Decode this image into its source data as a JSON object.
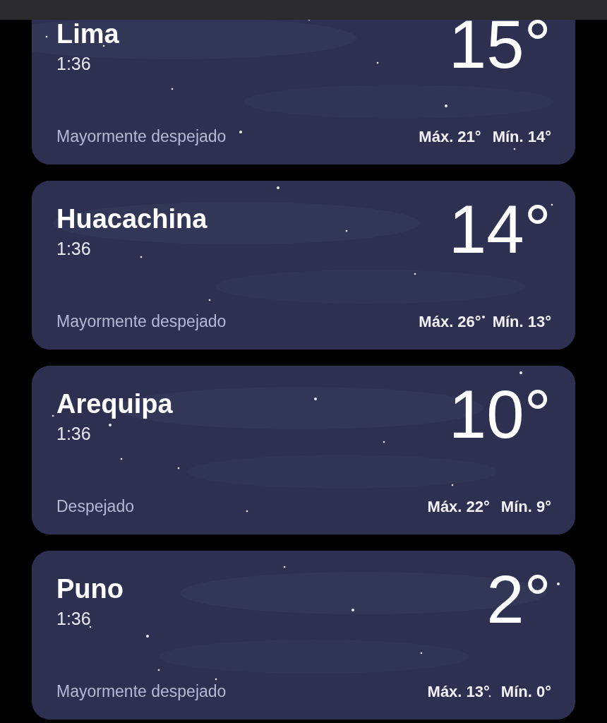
{
  "locations": [
    {
      "name": "Lima",
      "time": "1:36",
      "condition": "Mayormente despejado",
      "temperature": "15°",
      "high": "Máx. 21°",
      "low": "Mín. 14°"
    },
    {
      "name": "Huacachina",
      "time": "1:36",
      "condition": "Mayormente despejado",
      "temperature": "14°",
      "high": "Máx. 26°",
      "low": "Mín. 13°"
    },
    {
      "name": "Arequipa",
      "time": "1:36",
      "condition": "Despejado",
      "temperature": "10°",
      "high": "Máx. 22°",
      "low": "Mín. 9°"
    },
    {
      "name": "Puno",
      "time": "1:36",
      "condition": "Mayormente despejado",
      "temperature": "2°",
      "high": "Máx. 13°",
      "low": "Mín. 0°"
    }
  ]
}
